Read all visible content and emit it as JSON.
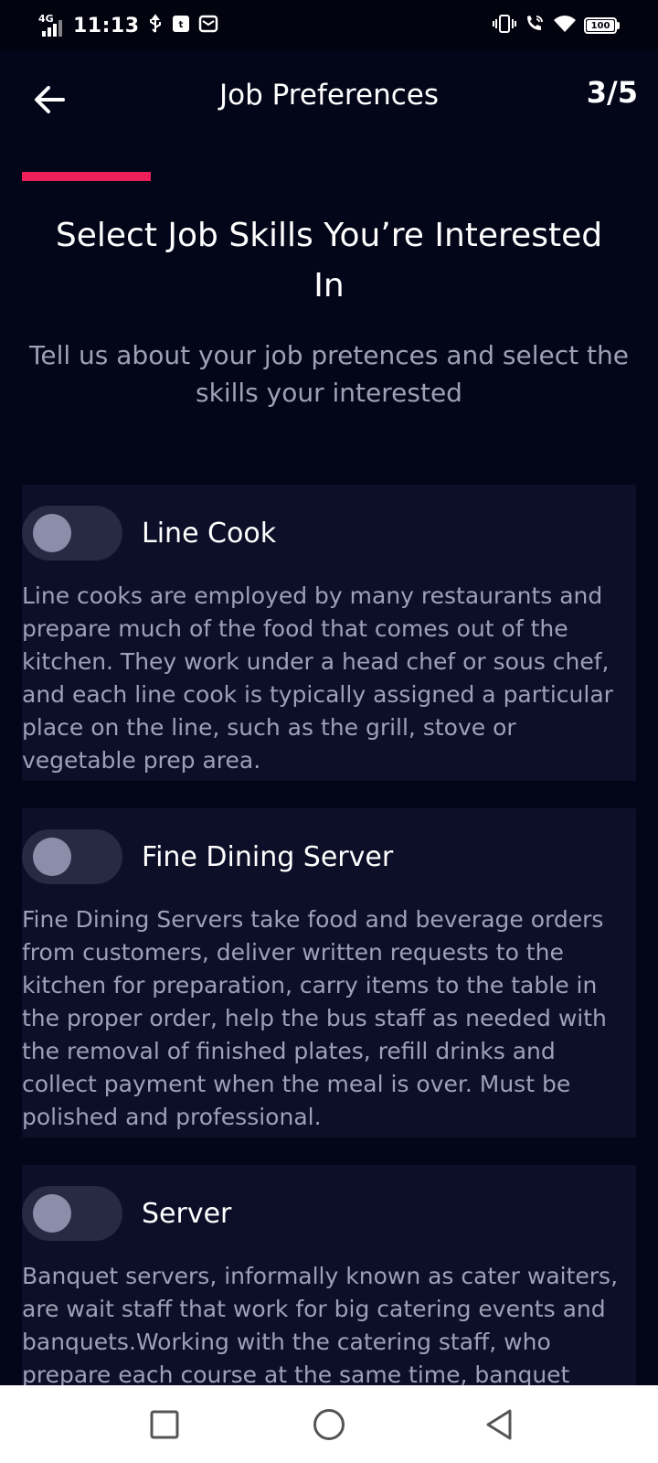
{
  "status_bar": {
    "network": "4G",
    "time": "11:13",
    "battery": "100"
  },
  "header": {
    "title": "Job Preferences",
    "step": "3/5"
  },
  "progress": {
    "fraction": 0.2
  },
  "intro": {
    "title": "Select Job Skills You’re Interested In",
    "subtitle": "Tell us about your job pretences and select the\nskills your interested"
  },
  "skills": [
    {
      "name": "Line Cook",
      "selected": false,
      "description": "Line cooks are employed by many restaurants and prepare much of the food that comes out of the kitchen. They work under a head chef or sous chef, and each line cook is typically assigned a particular place on the line, such as the grill, stove or vegetable prep area."
    },
    {
      "name": "Fine Dining Server",
      "selected": false,
      "description": "Fine Dining Servers take food and beverage orders from customers, deliver written requests to the kitchen for preparation, carry items to the table in the proper order, help the bus staff as needed with the removal of finished plates, refill drinks and collect payment when the meal is over. Must be polished and professional."
    },
    {
      "name": "Server",
      "selected": false,
      "description": "Banquet servers, informally known as cater waiters, are wait staff that work for big catering events and banquets.Working with the catering staff, who prepare each course at the same time, banquet servers must make sure each course is delivered as"
    }
  ],
  "colors": {
    "accent": "#ee1f5a",
    "background": "#030518",
    "card": "#0c0f27",
    "muted_text": "#9ea0b7"
  },
  "icons": {
    "back": "arrow-left-icon",
    "nav_recents": "square-icon",
    "nav_home": "circle-icon",
    "nav_back": "triangle-back-icon"
  }
}
